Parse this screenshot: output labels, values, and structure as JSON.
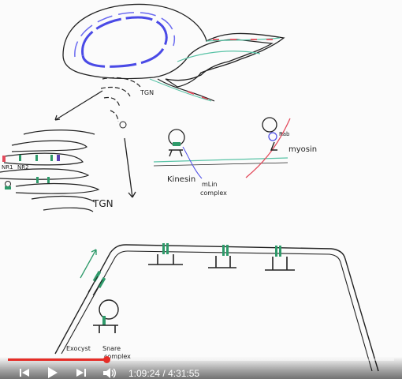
{
  "board": {
    "label_tgn_small": "TGN",
    "label_tgn_large": "TGN",
    "label_nr1": "NR1",
    "label_nr2": "NR2",
    "label_kinesin": "Kinesin",
    "label_rab": "Rab",
    "label_myosin": "myosin",
    "label_mlin_1": "mLin",
    "label_mlin_2": "complex",
    "label_exocyst": "Exocyst",
    "label_snare_1": "Snare",
    "label_snare_2": "complex"
  },
  "player": {
    "current_time": "1:09:24",
    "separator": " / ",
    "duration": "4:31:55",
    "progress": 0.255
  },
  "icons": {
    "previous": "skip-previous-icon",
    "play": "play-icon",
    "next": "skip-next-icon",
    "volume": "volume-icon"
  },
  "colors": {
    "progress": "#e52d27",
    "ink": "#222222",
    "blue_marker": "#4a4ae6",
    "green_marker": "#2e9a6a",
    "teal_marker": "#59c3a6",
    "red_marker": "#e34a5b"
  }
}
